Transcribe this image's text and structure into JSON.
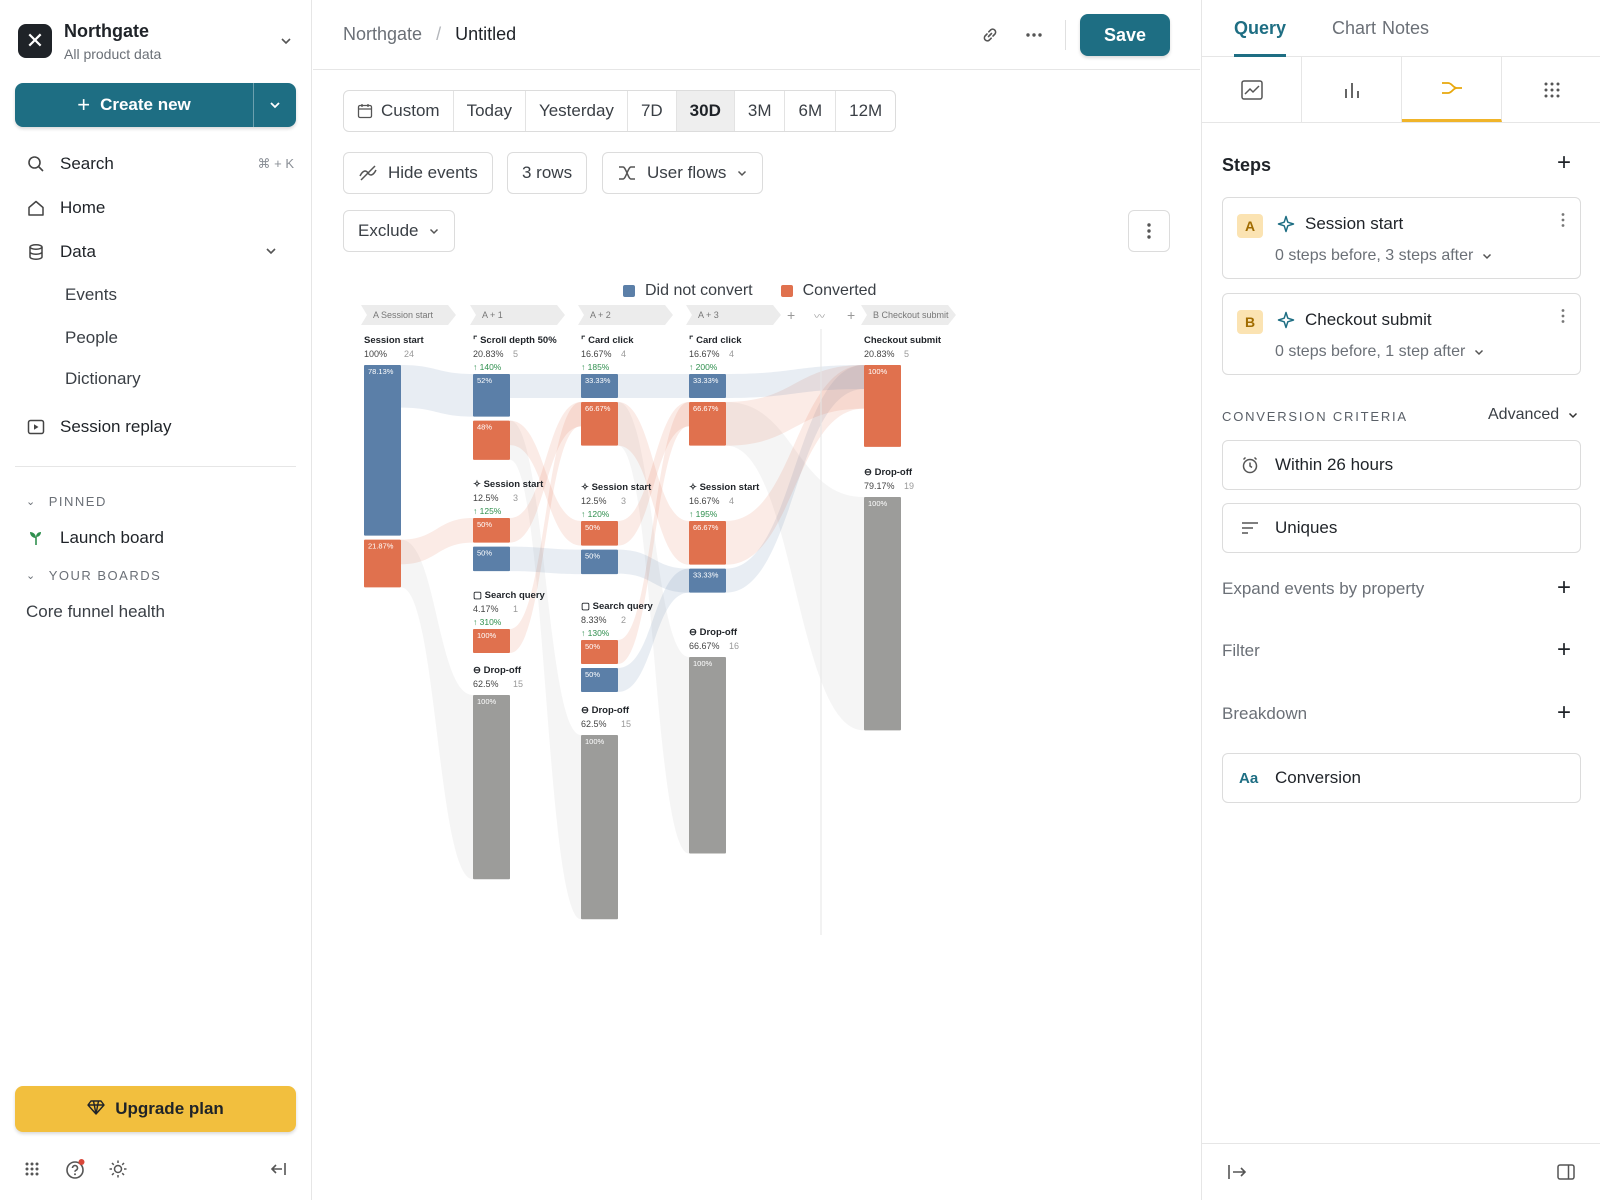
{
  "workspace": {
    "name": "Northgate",
    "subtitle": "All product data",
    "logo_glyph": "✕"
  },
  "sidebar": {
    "create_label": "Create new",
    "search_label": "Search",
    "search_shortcut": "⌘ + K",
    "home_label": "Home",
    "data_label": "Data",
    "data_items": [
      "Events",
      "People",
      "Dictionary"
    ],
    "session_replay_label": "Session replay",
    "pinned_header": "PINNED",
    "pinned_items": [
      "Launch board"
    ],
    "boards_header": "YOUR BOARDS",
    "board_items": [
      "Core funnel health"
    ],
    "upgrade_label": "Upgrade plan"
  },
  "header": {
    "crumb_root": "Northgate",
    "crumb_sep": "/",
    "crumb_current": "Untitled",
    "save_label": "Save"
  },
  "date_range": {
    "options": [
      "Custom",
      "Today",
      "Yesterday",
      "7D",
      "30D",
      "3M",
      "6M",
      "12M"
    ],
    "selected": "30D"
  },
  "controls": {
    "hide_events": "Hide events",
    "rows": "3 rows",
    "flows": "User flows",
    "exclude": "Exclude"
  },
  "chart_data": {
    "type": "sankey",
    "legend": [
      {
        "name": "Did not convert",
        "color": "#5b7fa8"
      },
      {
        "name": "Converted",
        "color": "#e0714e"
      }
    ],
    "columns": [
      {
        "header_tag": "A",
        "header": "Session start",
        "nodes": [
          {
            "name": "Session start",
            "pct": "100%",
            "count": "24",
            "change": "",
            "split": [
              [
                "78.13%",
                "blue"
              ],
              [
                "21.87%",
                "orange"
              ]
            ]
          }
        ]
      },
      {
        "header_tag": "",
        "header": "A + 1",
        "nodes": [
          {
            "name": "Scroll depth 50%",
            "pct": "20.83%",
            "count": "5",
            "change": "↑ 140%",
            "split": [
              [
                "52%",
                "blue"
              ],
              [
                "48%",
                "orange"
              ]
            ]
          },
          {
            "name": "Session start",
            "pct": "12.5%",
            "count": "3",
            "change": "↑ 125%",
            "split": [
              [
                "50%",
                "orange"
              ],
              [
                "50%",
                "blue"
              ]
            ]
          },
          {
            "name": "Search query",
            "pct": "4.17%",
            "count": "1",
            "change": "↑ 310%",
            "split": [
              [
                "100%",
                "orange"
              ]
            ]
          },
          {
            "name": "Drop-off",
            "pct": "62.5%",
            "count": "15",
            "change": "",
            "split": [
              [
                "100%",
                "gray"
              ]
            ]
          }
        ]
      },
      {
        "header_tag": "",
        "header": "A + 2",
        "nodes": [
          {
            "name": "Card click",
            "pct": "16.67%",
            "count": "4",
            "change": "↑ 185%",
            "split": [
              [
                "33.33%",
                "blue"
              ],
              [
                "66.67%",
                "orange"
              ]
            ]
          },
          {
            "name": "Session start",
            "pct": "12.5%",
            "count": "3",
            "change": "↑ 120%",
            "split": [
              [
                "50%",
                "orange"
              ],
              [
                "50%",
                "blue"
              ]
            ]
          },
          {
            "name": "Search query",
            "pct": "8.33%",
            "count": "2",
            "change": "↑ 130%",
            "split": [
              [
                "50%",
                "orange"
              ],
              [
                "50%",
                "blue"
              ]
            ]
          },
          {
            "name": "Drop-off",
            "pct": "62.5%",
            "count": "15",
            "change": "",
            "split": [
              [
                "100%",
                "gray"
              ]
            ]
          }
        ]
      },
      {
        "header_tag": "",
        "header": "A + 3",
        "nodes": [
          {
            "name": "Card click",
            "pct": "16.67%",
            "count": "4",
            "change": "↑ 200%",
            "split": [
              [
                "33.33%",
                "blue"
              ],
              [
                "66.67%",
                "orange"
              ]
            ]
          },
          {
            "name": "Session start",
            "pct": "16.67%",
            "count": "4",
            "change": "↑ 195%",
            "split": [
              [
                "66.67%",
                "orange"
              ],
              [
                "33.33%",
                "blue"
              ]
            ]
          },
          {
            "name": "Drop-off",
            "pct": "66.67%",
            "count": "16",
            "change": "",
            "split": [
              [
                "100%",
                "gray"
              ]
            ]
          }
        ]
      },
      {
        "header_tag": "B",
        "header": "Checkout submit",
        "nodes": [
          {
            "name": "Checkout submit",
            "pct": "20.83%",
            "count": "5",
            "change": "",
            "split": [
              [
                "100%",
                "orange"
              ]
            ]
          },
          {
            "name": "Drop-off",
            "pct": "79.17%",
            "count": "19",
            "change": "",
            "split": [
              [
                "100%",
                "gray"
              ]
            ]
          }
        ]
      }
    ]
  },
  "panel": {
    "tabs": [
      "Query",
      "Chart",
      "Notes"
    ],
    "active_tab": "Query",
    "steps_header": "Steps",
    "steps": [
      {
        "badge": "A",
        "name": "Session start",
        "detail": "0 steps before, 3 steps after"
      },
      {
        "badge": "B",
        "name": "Checkout submit",
        "detail": "0 steps before, 1 step after"
      }
    ],
    "criteria_header": "CONVERSION CRITERIA",
    "criteria_mode": "Advanced",
    "window_label": "Within 26 hours",
    "uniques_label": "Uniques",
    "expand_label": "Expand events by property",
    "filter_label": "Filter",
    "breakdown_label": "Breakdown",
    "aa_glyph": "Aa",
    "conversion_label": "Conversion"
  }
}
